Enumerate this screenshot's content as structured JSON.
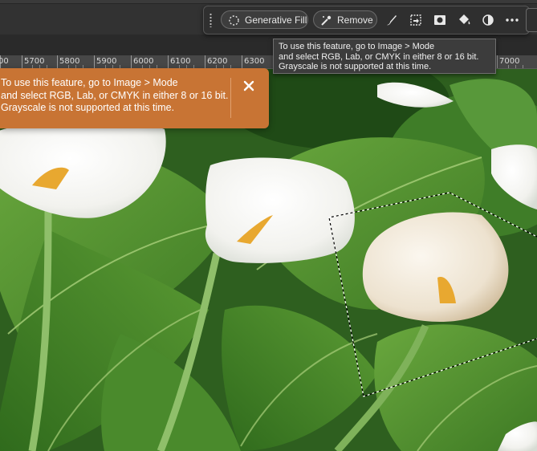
{
  "taskbar": {
    "generative_fill_label": "Generative Fill",
    "remove_label": "Remove",
    "icons": [
      "brush-icon",
      "select-subject-icon",
      "mask-icon",
      "fill-bucket-icon",
      "adjustment-icon",
      "more-icon"
    ]
  },
  "tooltip": {
    "line1": "To use this feature, go to Image > Mode",
    "line2": "and select RGB, Lab, or CMYK in either 8 or 16 bit.",
    "line3": "Grayscale is not supported at this time."
  },
  "toast": {
    "line1": "To use this feature, go to Image > Mode",
    "line2": "and select RGB, Lab, or CMYK in either 8 or 16 bit.",
    "line3": "Grayscale is not supported at this time.",
    "close_icon": "close-icon"
  },
  "ruler": {
    "labels": [
      "00",
      "5700",
      "5800",
      "5900",
      "6000",
      "6100",
      "6200",
      "6300",
      "7000"
    ]
  },
  "colors": {
    "toast_bg": "#c87434",
    "leaf_green": "#4e8f2e",
    "lily_white": "#f6f6f2",
    "spadix_yellow": "#e8a830"
  }
}
